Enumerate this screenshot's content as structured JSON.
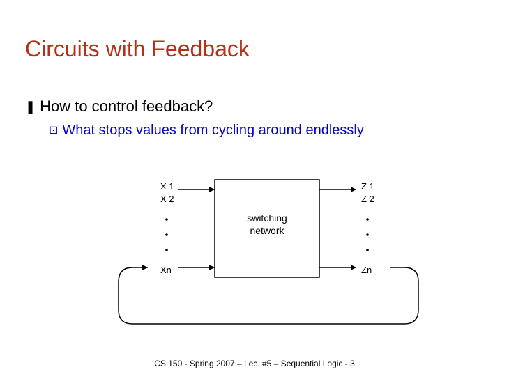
{
  "title": "Circuits with Feedback",
  "bullets": {
    "b1_symbol": "❚",
    "b1_text": "How to control feedback?",
    "b2_symbol": "⊡",
    "b2_text": "What stops values from cycling around endlessly"
  },
  "diagram": {
    "inputs": {
      "top1": "X 1",
      "top2": "X 2",
      "bottom": "Xn"
    },
    "outputs": {
      "top1": "Z 1",
      "top2": "Z 2",
      "bottom": "Zn"
    },
    "box_line1": "switching",
    "box_line2": "network"
  },
  "footer": "CS 150 - Spring  2007 – Lec. #5 – Sequential Logic - 3"
}
